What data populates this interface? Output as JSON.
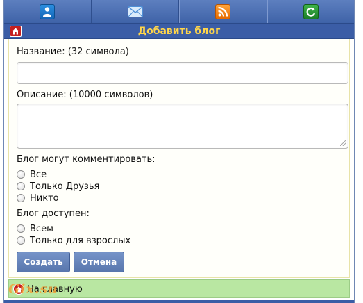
{
  "nav": {
    "items": [
      {
        "icon": "user-icon",
        "color": "#1a78cf"
      },
      {
        "icon": "mail-icon",
        "color": "#5a9be0"
      },
      {
        "icon": "rss-icon",
        "color": "#f28a14"
      },
      {
        "icon": "refresh-icon",
        "color": "#23902f"
      }
    ]
  },
  "header": {
    "title": "Добавить блог",
    "title_color": "#ffd54a"
  },
  "form": {
    "name_label": "Название: (32 символа)",
    "name_value": "",
    "description_label": "Описание: (10000 символов)",
    "description_value": "",
    "comment_label": "Блог могут комментировать:",
    "comment_options": [
      "Все",
      "Только Друзья",
      "Никто"
    ],
    "access_label": "Блог доступен:",
    "access_options": [
      "Всем",
      "Только для взрослых"
    ],
    "create_button": "Создать",
    "cancel_button": "Отмена"
  },
  "footer": {
    "home_link": "На главную"
  },
  "watermark": {
    "text": "Gix.su"
  }
}
